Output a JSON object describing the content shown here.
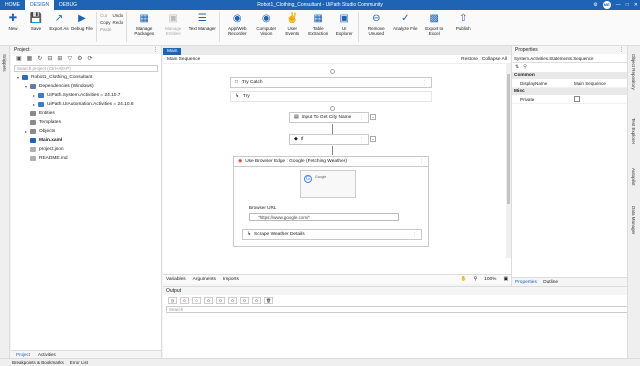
{
  "titlebar": {
    "menu": [
      "HOME",
      "DESIGN",
      "DEBUG"
    ],
    "title": "Robot1_Clothing_Consultant - UiPath Studio Community",
    "avatar": "ME"
  },
  "ribbon": {
    "new": "New",
    "save": "Save",
    "export_as": "Export As",
    "debug_file": "Debug File",
    "cut": "Cut",
    "copy": "Copy",
    "paste": "Paste",
    "undo": "Undo",
    "redo": "Redo",
    "manage_packages": "Manage Packages",
    "manage_entities": "Manage Entities",
    "text_manager": "Text Manager",
    "app_web_recorder": "App/Web Recorder",
    "computer_vision": "Computer Vision",
    "user_events": "User Events",
    "table_extraction": "Table Extraction",
    "ui_explorer": "UI Explorer",
    "remove_unused": "Remove Unused",
    "analyze_file": "Analyze File",
    "export_to_excel": "Export to Excel",
    "publish": "Publish"
  },
  "left": {
    "snippets": "Snippets",
    "header": "Project",
    "search_placeholder": "Search project (Ctrl+Alt+P)",
    "tree": [
      {
        "label": "Robot1_Clothing_Consultant",
        "depth": 0
      },
      {
        "label": "Dependencies (Windows)",
        "depth": 1
      },
      {
        "label": "UiPath.System.Activities = 24.10.7",
        "depth": 2
      },
      {
        "label": "UiPath.UIAutomation.Activities = 24.10.8",
        "depth": 2
      },
      {
        "label": "Entities",
        "depth": 1
      },
      {
        "label": "Templates",
        "depth": 1
      },
      {
        "label": "Objects",
        "depth": 1
      },
      {
        "label": "Main.xaml",
        "depth": 1
      },
      {
        "label": "project.json",
        "depth": 1
      },
      {
        "label": "README.md",
        "depth": 1
      }
    ],
    "tab_project": "Project",
    "tab_activities": "Activities"
  },
  "designer": {
    "tab": "Main",
    "breadcrumb": "Main Sequence",
    "restore": "Restore",
    "collapse_all": "Collapse All",
    "try_catch": "Try Catch",
    "try": "Try",
    "input_activity": "Input To Get City Name",
    "if_activity": "If",
    "browser_activity": "Use Browser Edge : Google (Fetching Weather)",
    "browser_url_label": "Browser URL",
    "browser_url_value": "\"https://www.google.com/\"",
    "scrape_activity": "Scrape Weather Details",
    "thumb_text": "Google"
  },
  "statusbar": {
    "variables": "Variables",
    "arguments": "Arguments",
    "imports": "Imports",
    "zoom": "100%"
  },
  "output": {
    "header": "Output",
    "counts": [
      "0",
      "0",
      "0",
      "0",
      "0",
      "0",
      "0"
    ],
    "search_placeholder": "Search"
  },
  "properties": {
    "header": "Properties",
    "path": "System.Activities.Statements.Sequence",
    "cat_common": "Common",
    "display_name_key": "DisplayName",
    "display_name_val": "Main Sequence",
    "cat_misc": "Misc",
    "private_key": "Private",
    "tab_properties": "Properties",
    "tab_outline": "Outline"
  },
  "rightstrip": {
    "object_repo": "Object Repository",
    "test_explorer": "Test Explorer",
    "autopilot": "Autopilot",
    "data_manager": "Data Manager"
  },
  "bottombar": {
    "breakpoints": "Breakpoints & Bookmarks",
    "error_list": "Error List"
  }
}
